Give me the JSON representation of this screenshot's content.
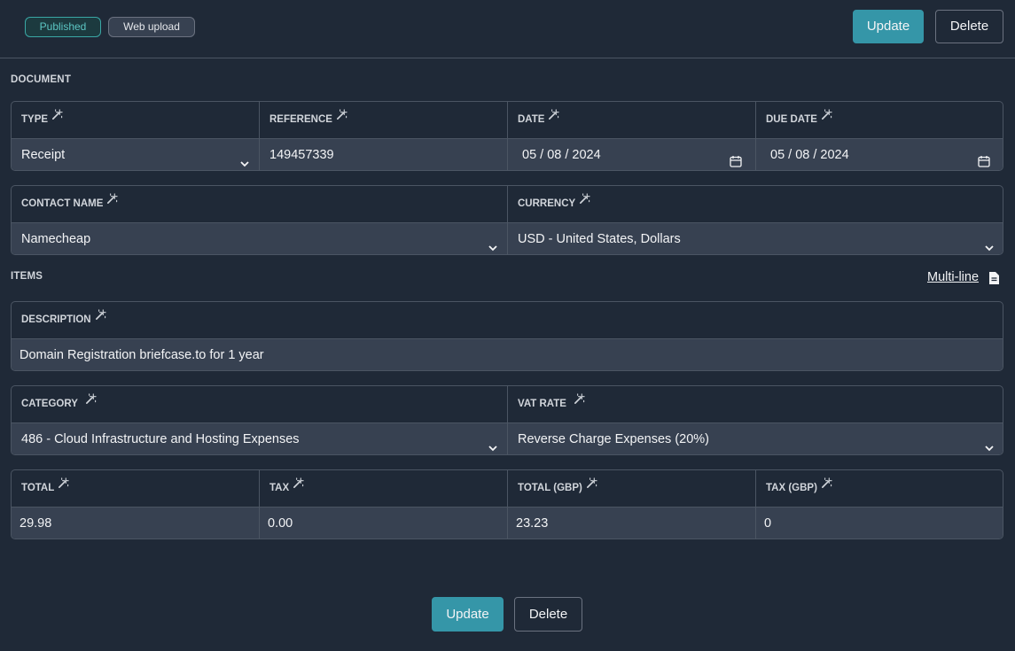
{
  "header": {
    "badges": {
      "published": "Published",
      "source": "Web upload"
    },
    "update_label": "Update",
    "delete_label": "Delete"
  },
  "document": {
    "section_label": "DOCUMENT",
    "type": {
      "label": "TYPE",
      "value": "Receipt"
    },
    "reference": {
      "label": "REFERENCE",
      "value": "149457339"
    },
    "date": {
      "label": "DATE",
      "value": "05 / 08 / 2024"
    },
    "due_date": {
      "label": "DUE DATE",
      "value": "05 / 08 / 2024"
    },
    "contact_name": {
      "label": "CONTACT NAME",
      "value": "Namecheap"
    },
    "currency": {
      "label": "CURRENCY",
      "value": "USD - United States, Dollars"
    }
  },
  "items": {
    "section_label": "ITEMS",
    "multiline_label": "Multi-line",
    "description": {
      "label": "DESCRIPTION",
      "value": "Domain Registration briefcase.to for 1 year"
    },
    "category": {
      "label": "CATEGORY",
      "value": "486 - Cloud Infrastructure and Hosting Expenses"
    },
    "vat_rate": {
      "label": "VAT RATE",
      "value": "Reverse Charge Expenses (20%)"
    },
    "total": {
      "label": "TOTAL",
      "value": "29.98"
    },
    "tax": {
      "label": "TAX",
      "value": "0.00"
    },
    "total_gbp": {
      "label": "TOTAL (GBP)",
      "value": "23.23"
    },
    "tax_gbp": {
      "label": "TAX (GBP)",
      "value": "0"
    }
  },
  "footer": {
    "update_label": "Update",
    "delete_label": "Delete"
  },
  "colors": {
    "background": "#1f2937",
    "field_background": "#374151",
    "accent": "#3596a8",
    "published_badge": "#3aa7a5"
  },
  "icons": {
    "ai_field": "magic-wand-icon",
    "dropdown": "chevron-down-icon",
    "date": "calendar-icon",
    "multiline": "document-icon"
  }
}
